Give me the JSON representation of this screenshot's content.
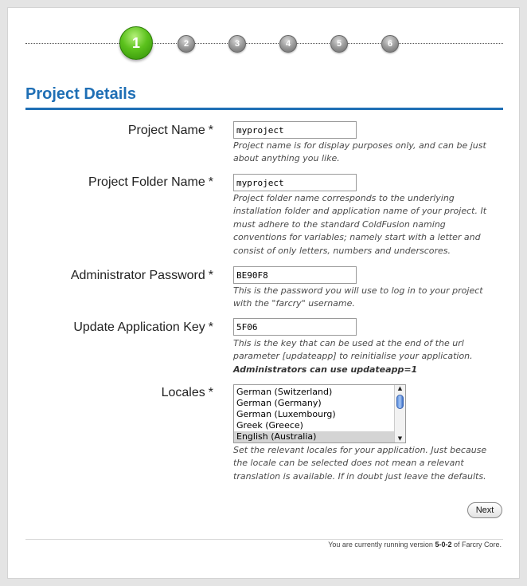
{
  "wizard": {
    "steps": [
      "1",
      "2",
      "3",
      "4",
      "5",
      "6"
    ],
    "active_step": 1
  },
  "section": {
    "title": "Project Details"
  },
  "fields": {
    "project_name": {
      "label": "Project Name",
      "required_mark": "*",
      "value": "myproject",
      "help": "Project name is for display purposes only, and can be just about anything you like."
    },
    "project_folder": {
      "label": "Project Folder Name",
      "required_mark": "*",
      "value": "myproject",
      "help": "Project folder name corresponds to the underlying installation folder and application name of your project. It must adhere to the standard ColdFusion naming conventions for variables; namely start with a letter and consist of only letters, numbers and underscores."
    },
    "admin_password": {
      "label": "Administrator Password",
      "required_mark": "*",
      "value": "BE90F8",
      "help": "This is the password you will use to log in to your project with the \"farcry\" username."
    },
    "update_key": {
      "label": "Update Application Key",
      "required_mark": "*",
      "value": "5F06",
      "help": "This is the key that can be used at the end of the url parameter [updateapp] to reinitialise your application.",
      "help_bold": "Administrators can use updateapp=1"
    },
    "locales": {
      "label": "Locales",
      "required_mark": "*",
      "options": [
        "German (Switzerland)",
        "German (Germany)",
        "German (Luxembourg)",
        "Greek (Greece)",
        "English (Australia)"
      ],
      "selected": "English (Australia)",
      "help": "Set the relevant locales for your application. Just because the locale can be selected does not mean a relevant translation is available. If in doubt just leave the defaults."
    }
  },
  "actions": {
    "next_label": "Next"
  },
  "footer": {
    "prefix": "You are currently running version",
    "version": "5-0-2",
    "suffix": "of Farcry Core."
  },
  "colors": {
    "heading_blue": "#1f6fb5",
    "active_step_green": "#5cc21d"
  }
}
